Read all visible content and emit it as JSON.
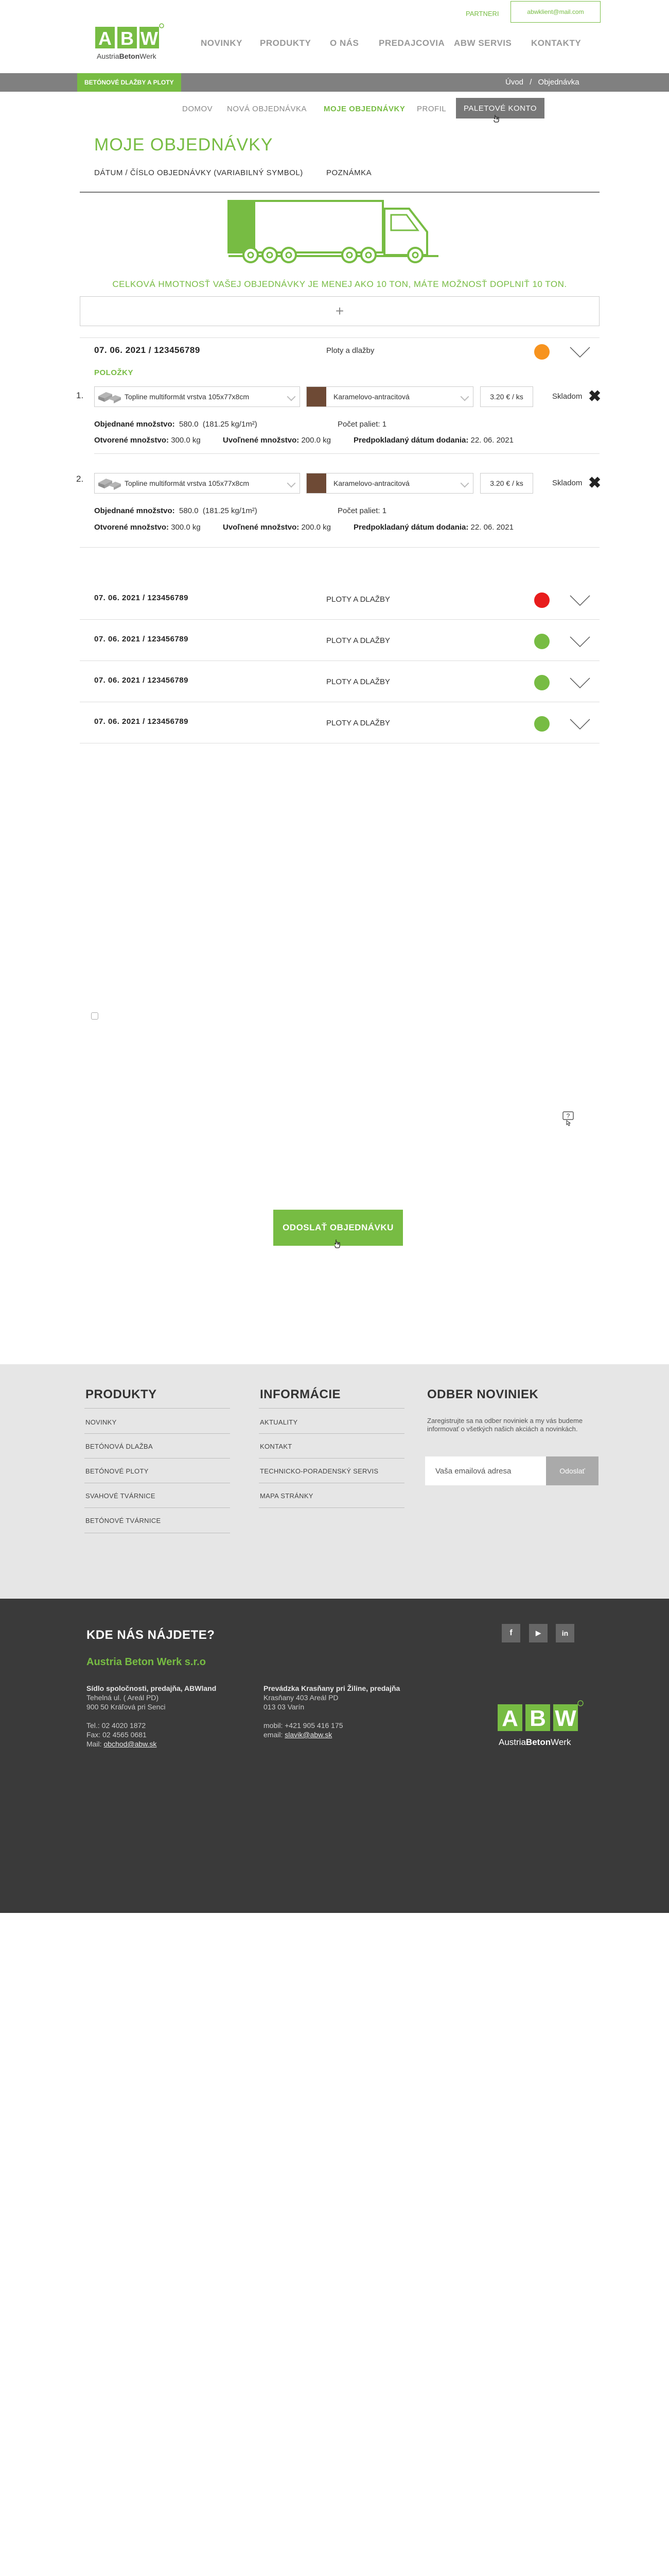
{
  "header": {
    "partneri": "PARTNERI",
    "user_email": "abwklient@mail.com",
    "logo_text": "ABW",
    "logo_sub_left": "Austria",
    "logo_sub_bold": "Beton",
    "logo_sub_right": "Werk",
    "nav": [
      "NOVINKY",
      "PRODUKTY",
      "O NÁS",
      "PREDAJCOVIA",
      "ABW SERVIS",
      "KONTAKTY"
    ]
  },
  "graybar": {
    "tag": "BETÓNOVÉ DLAŽBY A PLOTY",
    "breadcrumb_home": "Úvod",
    "breadcrumb_sep": "/",
    "breadcrumb_current": "Objednávka"
  },
  "subnav": {
    "items": [
      "DOMOV",
      "NOVÁ OBJEDNÁVKA",
      "MOJE OBJEDNÁVKY",
      "PROFIL"
    ],
    "paletove": "PALETOVÉ KONTO"
  },
  "page": {
    "title": "MOJE OBJEDNÁVKY",
    "col1": "DÁTUM / ČÍSLO OBJEDNÁVKY (VARIABILNÝ SYMBOL)",
    "col2": "POZNÁMKA",
    "notice": "CELKOVÁ HMOTNOSŤ VAŠEJ OBJEDNÁVKY JE MENEJ AKO 10 TON, MÁTE MOŽNOSŤ DOPLNIŤ 10 TON.",
    "add_symbol": "+"
  },
  "expanded_order": {
    "head": "07. 06. 2021 / 123456789",
    "category": "Ploty a dlažby",
    "status_color": "#f7931e",
    "items_title": "POLOŽKY",
    "items": [
      {
        "num": "1.",
        "product": "Topline multiformát vrstva 105x77x8cm",
        "color": "Karamelovo-antracitová",
        "price": "3.20 € / ks",
        "stock": "Skladom",
        "ordered_label": "Objednané množstvo:",
        "ordered_value": "580.0",
        "ordered_extra": "(181.25 kg/1m²)",
        "pallets_label": "Počet paliet:",
        "pallets_value": "1",
        "open_label": "Otvorené množstvo:",
        "open_value": "300.0 kg",
        "released_label": "Uvoľnené množstvo:",
        "released_value": "200.0 kg",
        "date_label": "Predpokladaný dátum dodania:",
        "date_value": "22. 06. 2021"
      },
      {
        "num": "2.",
        "product": "Topline multiformát vrstva 105x77x8cm",
        "color": "Karamelovo-antracitová",
        "price": "3.20 € / ks",
        "stock": "Skladom",
        "ordered_label": "Objednané množstvo:",
        "ordered_value": "580.0",
        "ordered_extra": "(181.25 kg/1m²)",
        "pallets_label": "Počet paliet:",
        "pallets_value": "1",
        "open_label": "Otvorené množstvo:",
        "open_value": "300.0 kg",
        "released_label": "Uvoľnené množstvo:",
        "released_value": "200.0 kg",
        "date_label": "Predpokladaný dátum dodania:",
        "date_value": "22. 06. 2021"
      }
    ]
  },
  "orders": [
    {
      "head": "07. 06. 2021 / 123456789",
      "category": "PLOTY A DLAŽBY",
      "status_color": "#e81c1c"
    },
    {
      "head": "07. 06. 2021 / 123456789",
      "category": "PLOTY A DLAŽBY",
      "status_color": "#77bc43"
    },
    {
      "head": "07. 06. 2021 / 123456789",
      "category": "PLOTY A DLAŽBY",
      "status_color": "#77bc43"
    },
    {
      "head": "07. 06. 2021 / 123456789",
      "category": "PLOTY A DLAŽBY",
      "status_color": "#77bc43"
    }
  ],
  "submit": "ODOSLAŤ OBJEDNÁVKU",
  "footer": {
    "produkty_title": "PRODUKTY",
    "produkty": [
      "NOVINKY",
      "BETÓNOVÁ DLAŽBA",
      "BETÓNOVÉ PLOTY",
      "SVAHOVÉ TVÁRNICE",
      "BETÓNOVÉ TVÁRNICE"
    ],
    "info_title": "INFORMÁCIE",
    "info": [
      "AKTUALITY",
      "KONTAKT",
      "TECHNICKO-PORADENSKÝ SERVIS",
      "MAPA STRÁNKY"
    ],
    "odber_title": "ODBER NOVINIEK",
    "odber_text": "Zaregistrujte sa na odber noviniek a my vás budeme informovať o všetkých našich akciách a novinkách.",
    "email_placeholder": "Vaša emailová adresa",
    "odoslat": "Odoslať",
    "kde": "KDE NÁS NÁJDETE?",
    "company": "Austria Beton Werk s.r.o",
    "sidlo_title": "Sídlo spoločnosti, predajňa, ABWland",
    "sidlo_lines": [
      "Tehelná ul. ( Areál PD)",
      "900 50 Kráľová pri Senci"
    ],
    "tel": "Tel.: 02 4020 1872",
    "fax": "Fax: 02 4565 0681",
    "mail_label": "Mail:",
    "mail_link": "obchod@abw.sk",
    "prevadzka_title": "Prevádzka Krasňany pri Žiline, predajňa",
    "prevadzka_lines": [
      "Krasňany 403 Areál PD",
      "013 03 Varín"
    ],
    "mobil": "mobil: +421 905 416 175",
    "email_label": "email:",
    "email_link": "slavik@abw.sk",
    "social": [
      "f",
      "▶",
      "in"
    ]
  }
}
